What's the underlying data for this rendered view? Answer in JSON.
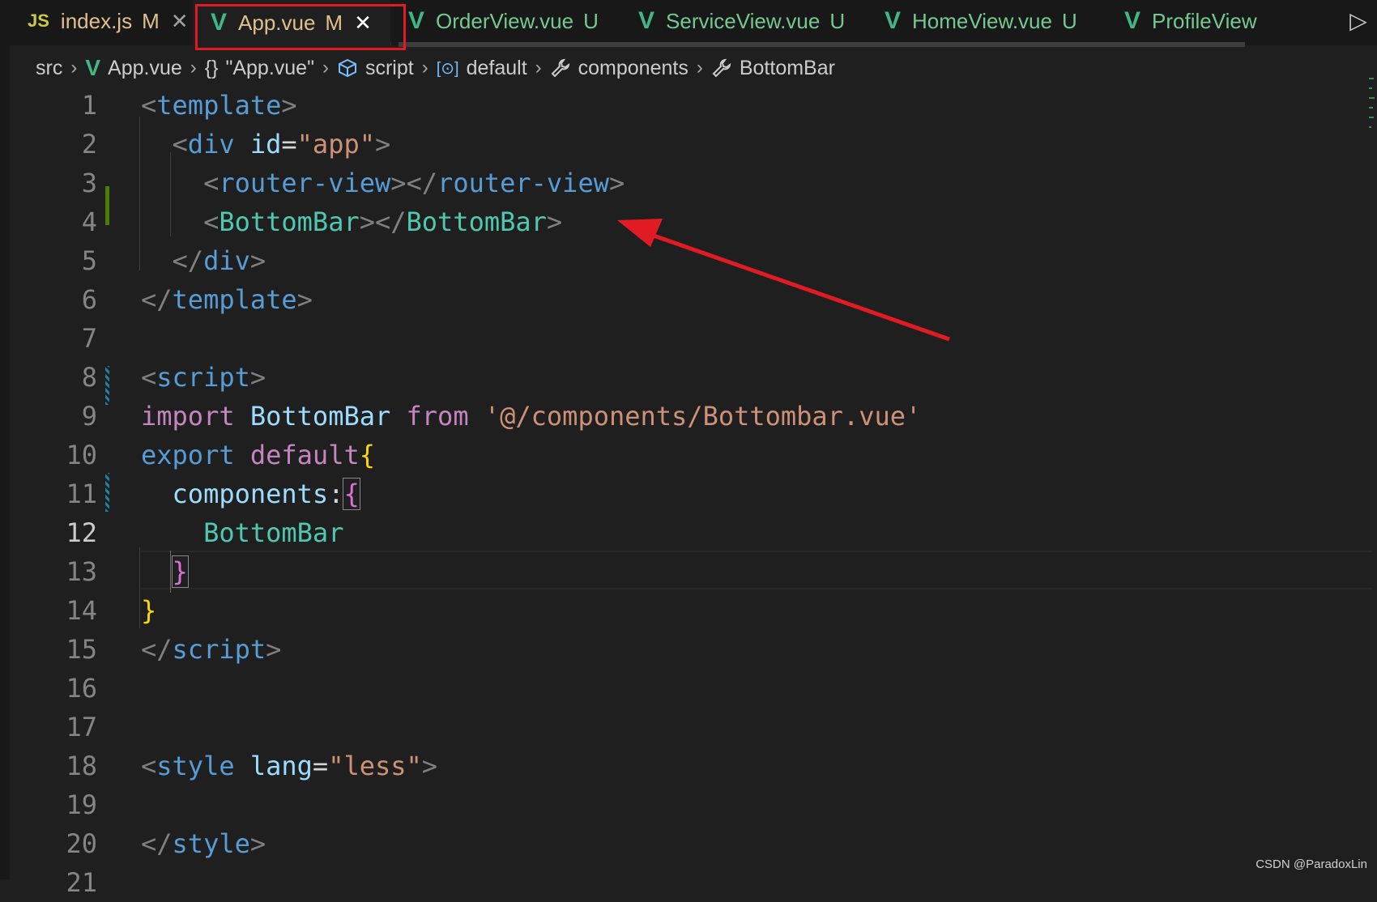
{
  "tabs": [
    {
      "icon": "js-icon",
      "label": "index.js",
      "badge": "M",
      "badge_kind": "modified",
      "close": "✕",
      "active": false
    },
    {
      "icon": "vue-icon",
      "label": "App.vue",
      "badge": "M",
      "badge_kind": "modified",
      "close": "✕",
      "active": true
    },
    {
      "icon": "vue-icon",
      "label": "OrderView.vue",
      "badge": "U",
      "badge_kind": "untracked",
      "active": false
    },
    {
      "icon": "vue-icon",
      "label": "ServiceView.vue",
      "badge": "U",
      "badge_kind": "untracked",
      "active": false
    },
    {
      "icon": "vue-icon",
      "label": "HomeView.vue",
      "badge": "U",
      "badge_kind": "untracked",
      "active": false
    },
    {
      "icon": "vue-icon",
      "label": "ProfileView",
      "badge": "",
      "active": false
    }
  ],
  "tab_icon_text": {
    "js": "JS",
    "vue": "V"
  },
  "breadcrumbs": [
    {
      "icon": "",
      "label": "src"
    },
    {
      "icon": "vue-icon",
      "label": "App.vue"
    },
    {
      "icon": "braces-icon",
      "label": "\"App.vue\""
    },
    {
      "icon": "cube-icon",
      "label": "script"
    },
    {
      "icon": "namespace-icon",
      "label": "default"
    },
    {
      "icon": "wrench-icon",
      "label": "components"
    },
    {
      "icon": "wrench-icon",
      "label": "BottomBar"
    }
  ],
  "breadcrumb_glyphs": {
    "braces": "{}",
    "namespace": "[⊙]",
    "wrench": "🔧"
  },
  "editor": {
    "current_line": 12,
    "lines": [
      {
        "n": "1",
        "tokens": [
          [
            "t-punc",
            "<"
          ],
          [
            "t-tag",
            "template"
          ],
          [
            "t-punc",
            ">"
          ]
        ]
      },
      {
        "n": "2",
        "tokens": [
          [
            "t-eq",
            "  "
          ],
          [
            "t-punc",
            "<"
          ],
          [
            "t-tag",
            "div"
          ],
          [
            "t-eq",
            " "
          ],
          [
            "t-attr",
            "id"
          ],
          [
            "t-eq",
            "="
          ],
          [
            "t-str",
            "\"app\""
          ],
          [
            "t-punc",
            ">"
          ]
        ]
      },
      {
        "n": "3",
        "tokens": [
          [
            "t-eq",
            "    "
          ],
          [
            "t-punc",
            "<"
          ],
          [
            "t-tag",
            "router-view"
          ],
          [
            "t-punc",
            "></"
          ],
          [
            "t-tag",
            "router-view"
          ],
          [
            "t-punc",
            ">"
          ]
        ]
      },
      {
        "n": "4",
        "tokens": [
          [
            "t-eq",
            "    "
          ],
          [
            "t-punc",
            "<"
          ],
          [
            "t-comp",
            "BottomBar"
          ],
          [
            "t-punc",
            "></"
          ],
          [
            "t-comp",
            "BottomBar"
          ],
          [
            "t-punc",
            ">"
          ]
        ]
      },
      {
        "n": "5",
        "tokens": [
          [
            "t-eq",
            "  "
          ],
          [
            "t-punc",
            "</"
          ],
          [
            "t-tag",
            "div"
          ],
          [
            "t-punc",
            ">"
          ]
        ]
      },
      {
        "n": "6",
        "tokens": [
          [
            "t-punc",
            "</"
          ],
          [
            "t-tag",
            "template"
          ],
          [
            "t-punc",
            ">"
          ]
        ]
      },
      {
        "n": "7",
        "tokens": []
      },
      {
        "n": "8",
        "tokens": [
          [
            "t-punc",
            "<"
          ],
          [
            "t-tag",
            "script"
          ],
          [
            "t-punc",
            ">"
          ]
        ]
      },
      {
        "n": "9",
        "tokens": [
          [
            "t-kw",
            "import"
          ],
          [
            "t-eq",
            " "
          ],
          [
            "t-attr",
            "BottomBar"
          ],
          [
            "t-eq",
            " "
          ],
          [
            "t-kw",
            "from"
          ],
          [
            "t-eq",
            " "
          ],
          [
            "t-str",
            "'@/components/Bottombar.vue'"
          ]
        ]
      },
      {
        "n": "10",
        "tokens": [
          [
            "t-kw2",
            "export"
          ],
          [
            "t-eq",
            " "
          ],
          [
            "t-kw",
            "default"
          ],
          [
            "t-brace1",
            "{"
          ]
        ]
      },
      {
        "n": "11",
        "tokens": [
          [
            "t-eq",
            "  "
          ],
          [
            "t-prop",
            "components"
          ],
          [
            "t-eq",
            ":"
          ],
          [
            "t-brace2 bracket-box",
            "{"
          ]
        ]
      },
      {
        "n": "12",
        "tokens": [
          [
            "t-eq",
            "    "
          ],
          [
            "t-comp",
            "BottomBar"
          ]
        ]
      },
      {
        "n": "13",
        "tokens": [
          [
            "t-eq",
            "  "
          ],
          [
            "t-brace2 bracket-box",
            "}"
          ]
        ]
      },
      {
        "n": "14",
        "tokens": [
          [
            "t-brace1",
            "}"
          ]
        ]
      },
      {
        "n": "15",
        "tokens": [
          [
            "t-punc",
            "</"
          ],
          [
            "t-tag",
            "script"
          ],
          [
            "t-punc",
            ">"
          ]
        ]
      },
      {
        "n": "16",
        "tokens": []
      },
      {
        "n": "17",
        "tokens": []
      },
      {
        "n": "18",
        "tokens": [
          [
            "t-punc",
            "<"
          ],
          [
            "t-tag",
            "style"
          ],
          [
            "t-eq",
            " "
          ],
          [
            "t-attr",
            "lang"
          ],
          [
            "t-eq",
            "="
          ],
          [
            "t-str",
            "\"less\""
          ],
          [
            "t-punc",
            ">"
          ]
        ]
      },
      {
        "n": "19",
        "tokens": []
      },
      {
        "n": "20",
        "tokens": [
          [
            "t-punc",
            "</"
          ],
          [
            "t-tag",
            "style"
          ],
          [
            "t-punc",
            ">"
          ]
        ]
      },
      {
        "n": "21",
        "tokens": []
      }
    ]
  },
  "overflow_glyph": "▷",
  "watermark": "CSDN @ParadoxLin",
  "colors": {
    "annotation_red": "#e01b24",
    "vue_green": "#41b883"
  }
}
